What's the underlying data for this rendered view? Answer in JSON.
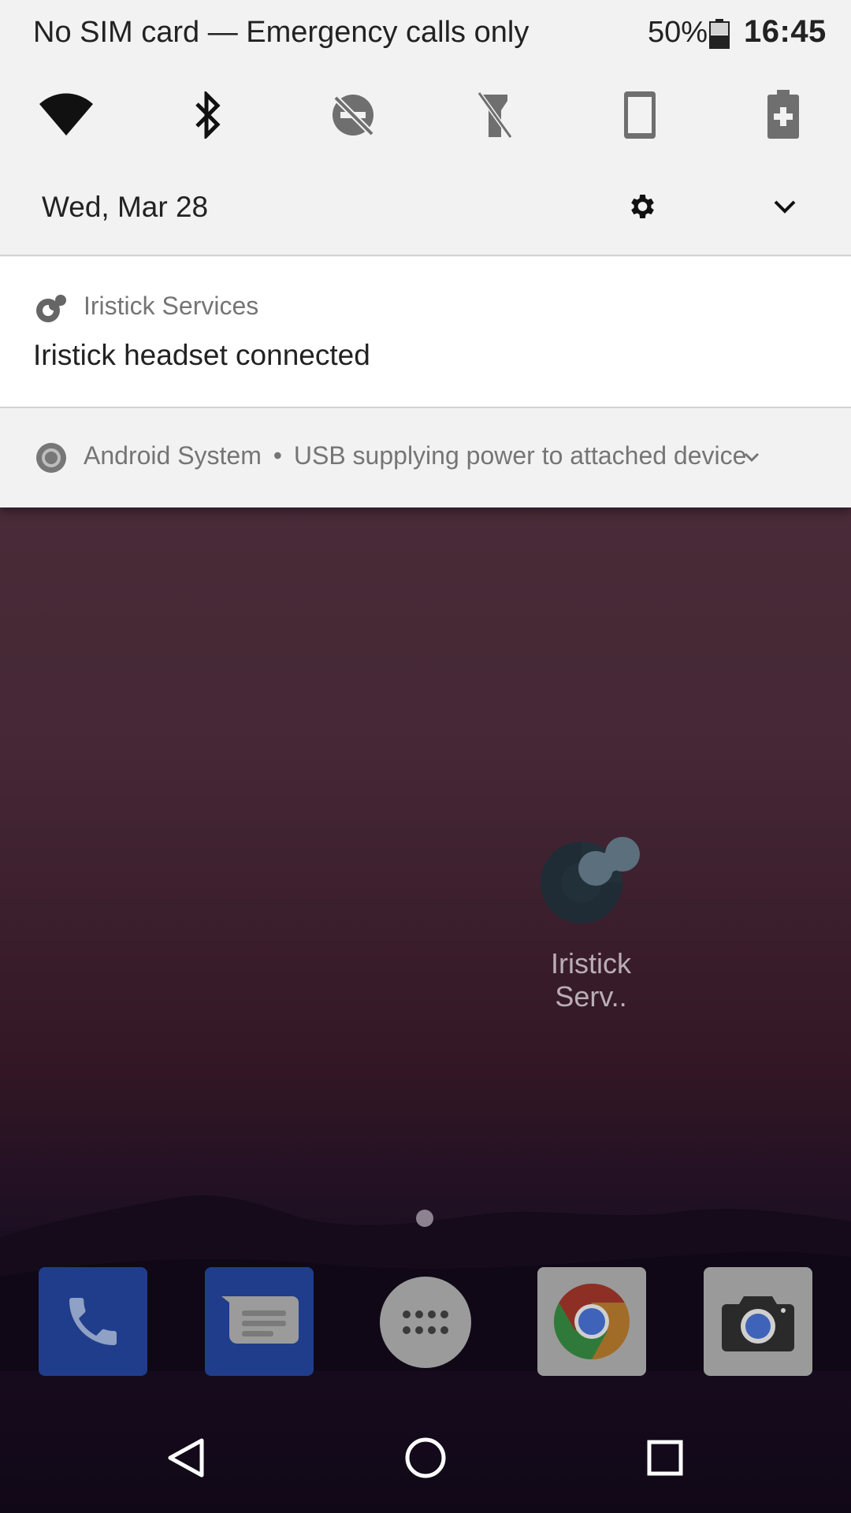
{
  "status_bar": {
    "carrier_text": "No SIM card — Emergency calls only",
    "battery_percent": "50%",
    "battery_level": 0.5,
    "time": "16:45"
  },
  "quick_settings": [
    {
      "name": "wifi",
      "icon": "wifi-icon",
      "state": "on"
    },
    {
      "name": "bluetooth",
      "icon": "bluetooth-icon",
      "state": "on"
    },
    {
      "name": "do-not-disturb",
      "icon": "dnd-off-icon",
      "state": "off"
    },
    {
      "name": "flashlight",
      "icon": "flashlight-off-icon",
      "state": "off"
    },
    {
      "name": "auto-rotate",
      "icon": "phone-portrait-icon",
      "state": "off"
    },
    {
      "name": "battery-saver",
      "icon": "battery-saver-icon",
      "state": "off"
    }
  ],
  "header": {
    "date": "Wed, Mar 28"
  },
  "notifications": [
    {
      "app_name": "Iristick Services",
      "title": "Iristick headset connected",
      "icon": "iristick-icon"
    },
    {
      "app_name": "Android System",
      "separator": "•",
      "text": "USB supplying power to attached device",
      "icon": "android-system-icon"
    }
  ],
  "home": {
    "shortcut_label": "Iristick Serv..",
    "dock": [
      {
        "name": "phone",
        "icon": "phone-icon"
      },
      {
        "name": "messages",
        "icon": "messages-icon"
      },
      {
        "name": "app-drawer",
        "icon": "app-drawer-icon"
      },
      {
        "name": "chrome",
        "icon": "chrome-icon"
      },
      {
        "name": "camera",
        "icon": "camera-icon"
      }
    ]
  },
  "colors": {
    "shade_bg": "#f2f2f2",
    "notification_bg": "#ffffff",
    "text_primary": "#222222",
    "text_secondary": "#757575",
    "wallpaper_top": "#4a2f3c",
    "wallpaper_bottom": "#150a1d"
  }
}
